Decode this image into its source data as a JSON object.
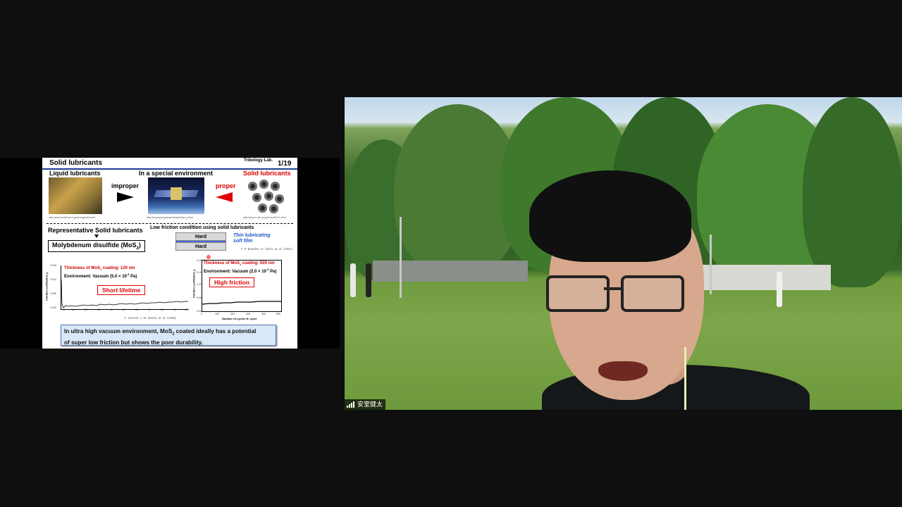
{
  "slide": {
    "title": "Solid lubricants",
    "logo_text": "Tribology Lab.",
    "page": "1/19",
    "headers": {
      "liquid": "Liquid lubricants",
      "special_env": "In a special environment",
      "solid": "Solid lubricants"
    },
    "improper": "improper",
    "proper": "proper",
    "urls": {
      "liquid": "http://www.exxlilonw.co.jp/energy/lubricant/",
      "special": "http://www.jaxa.jp/projects/sat/index_j.html",
      "solid": "http://www.n-ntn.co.jp/menu/03-01.html"
    },
    "section_title": "Representative Solid lubricants",
    "mos2": "Molybdenum disulfide (MoS",
    "mos2_sub": "2",
    "mos2_close": ")",
    "condition_title": "Low friction condition using solid lubricants",
    "hard1": "Hard",
    "hard2": "Hard",
    "film_line1": "Thin lubricating",
    "film_line2": "soft film",
    "cite_bowden": "F. P. Bowden, D. Tabor, et. al. (1961)",
    "plot1": {
      "note_line1": "Thickness of MoS",
      "note_line1_sub": "2",
      "note_line1_end": " coating: 120 nm",
      "note_line2": "Environment: Vacuum (5.0 × 10",
      "note_line2_sup": "-8",
      "note_line2_end": " Pa)",
      "label": "Short lifetime",
      "ylabel": "Friction coefficient, μ",
      "yticks": [
        "0.015",
        "0.010",
        "0.005",
        "0.000"
      ],
      "xticks": [
        "0",
        "10",
        "20",
        "30",
        "40",
        "50",
        "60",
        "70",
        "80",
        "90",
        "100"
      ],
      "cite": "C. Donnet, J. M. Martin, et. al. (1996)"
    },
    "plot2": {
      "note_line1": "Thickness of MoS",
      "note_line1_sub": "2",
      "note_line1_end": " coating: 500 nm",
      "note_line2": "Environment: Vacuum (2.0 × 10",
      "note_line2_sup": "-5",
      "note_line2_end": " Pa)",
      "label": "High friction",
      "ylabel": "Friction coefficient, μ",
      "yticks": [
        "0.20",
        "0.15",
        "0.10",
        "0.05",
        "0.00"
      ],
      "xticks": [
        "0",
        "100",
        "200",
        "300",
        "400",
        "500"
      ],
      "xlabel": "Number of cycles N, cycle"
    },
    "summary_line1a": "In ultra high vacuum environment, MoS",
    "summary_sub": "2",
    "summary_line1b": " coated ideally has a potential",
    "summary_line2": "of super low friction but shows the poor durability."
  },
  "video": {
    "participant_name": "安室健太"
  }
}
